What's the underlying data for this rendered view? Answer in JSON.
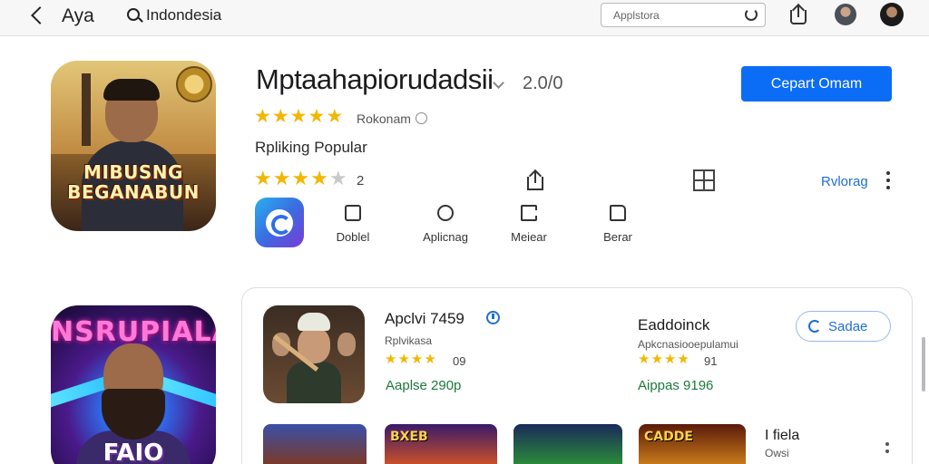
{
  "topbar": {
    "back_label": "Aya",
    "breadcrumb": "Indondesia",
    "search_placeholder": "Applstora",
    "icons": [
      "chevron-left-icon",
      "search-icon",
      "refresh-icon",
      "share-icon"
    ]
  },
  "app": {
    "name": "Mptaahapiorudadsii",
    "version": "2.0/0",
    "primary_action": "Cepart Omam",
    "rating_label": "Rokonam",
    "rating_stars": 5,
    "category": "Rpliking Popular",
    "user_rating_stars": 4.5,
    "user_rating_count": "2",
    "more_link": "Rvlorag",
    "icon_title": "MIBUSNG BEGANABUN",
    "tools": [
      "Doblel",
      "Aplicnag",
      "Meiear",
      "Berar"
    ]
  },
  "second_app": {
    "icon_title": "NSRUPIALA",
    "icon_subtitle": "FAIO"
  },
  "recommended": {
    "item1": {
      "name": "Apclvi 7459",
      "subtitle": "Rplvikasa",
      "stars": 4,
      "count": "09",
      "price": "Aaplse 290p"
    },
    "item2": {
      "name": "Eaddoinck",
      "subtitle": "Apkcnasiooepulamui",
      "stars": 4,
      "count": "91",
      "price": "Aippas 9196",
      "button": "Sadae"
    },
    "thumbnails": [
      {
        "title": ""
      },
      {
        "title": "BXEB"
      },
      {
        "title": ""
      },
      {
        "title": "CADDE"
      }
    ],
    "side_title": "I fiela",
    "side_subtitle": "Owsi"
  },
  "colors": {
    "primary": "#0b6cf5",
    "link": "#1f6fd0",
    "star": "#f2b705",
    "price": "#1a7a3a"
  }
}
